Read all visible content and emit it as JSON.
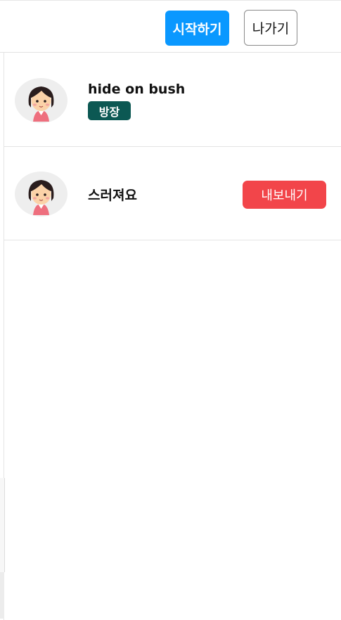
{
  "header": {
    "start_label": "시작하기",
    "exit_label": "나가기",
    "start_color": "#0a98ff"
  },
  "players": [
    {
      "name": "hide on bush",
      "badge": "방장",
      "avatar_icon": "girl-avatar-icon"
    },
    {
      "name": "스러져요",
      "action_label": "내보내기",
      "avatar_icon": "girl-avatar-icon"
    }
  ],
  "colors": {
    "host_badge": "#0c5853",
    "kick_button": "#f2454a"
  }
}
